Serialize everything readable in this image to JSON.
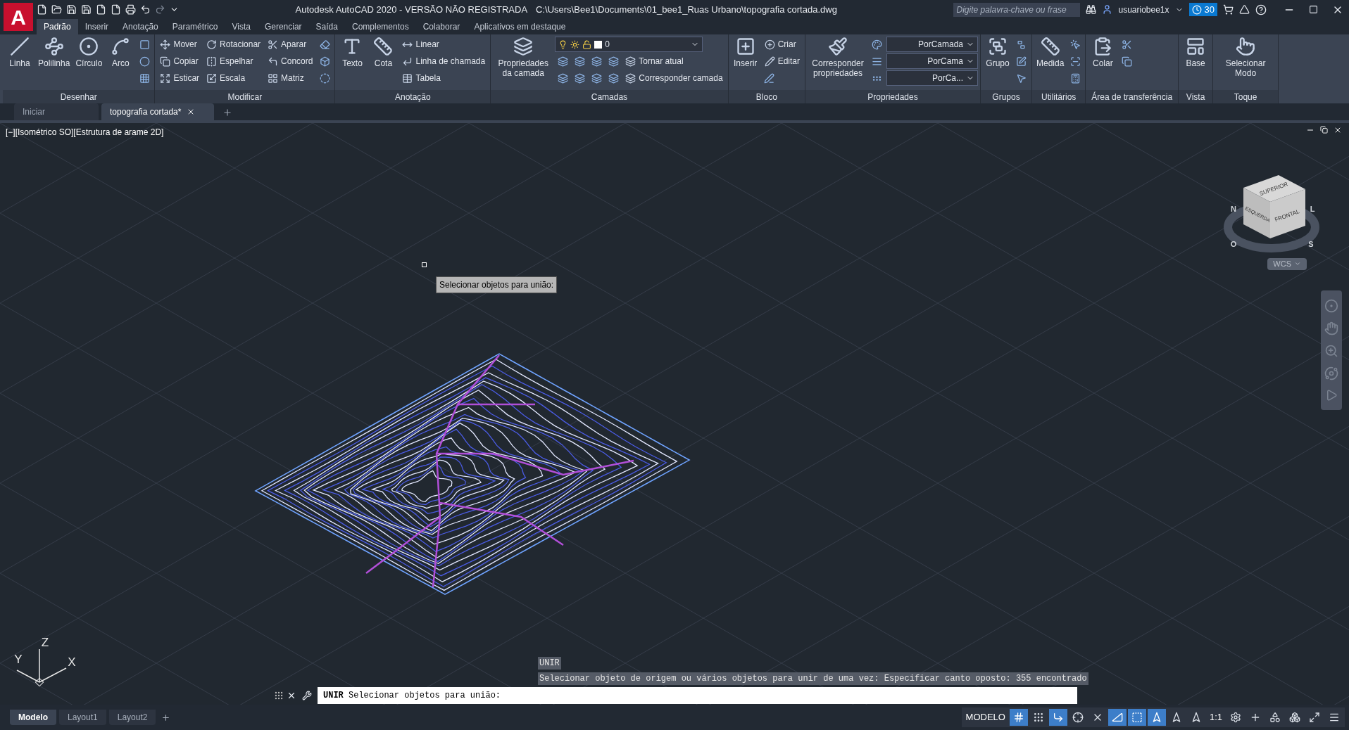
{
  "logo_letter": "A",
  "app_title": "Autodesk AutoCAD 2020 - VERSÃO NÃO REGISTRADA",
  "file_path": "C:\\Users\\Bee1\\Documents\\01_bee1_Ruas Urbano\\topografia cortada.dwg",
  "search": {
    "placeholder": "Digite palavra-chave ou frase"
  },
  "user": "usuariobee1x",
  "trial_days": "30",
  "ribbon_tabs": [
    {
      "label": "Padrão",
      "selected": true
    },
    {
      "label": "Inserir",
      "selected": false
    },
    {
      "label": "Anotação",
      "selected": false
    },
    {
      "label": "Paramétrico",
      "selected": false
    },
    {
      "label": "Vista",
      "selected": false
    },
    {
      "label": "Gerenciar",
      "selected": false
    },
    {
      "label": "Saída",
      "selected": false
    },
    {
      "label": "Complementos",
      "selected": false
    },
    {
      "label": "Colaborar",
      "selected": false
    },
    {
      "label": "Aplicativos em destaque",
      "selected": false
    }
  ],
  "ribbon_panels": [
    {
      "title": "Desenhar",
      "large": [
        "Linha",
        "Polilinha",
        "Círculo",
        "Arco"
      ],
      "rows": [
        [
          {
            "kind": "icon"
          }
        ],
        [
          {
            "kind": "icon"
          }
        ],
        [
          {
            "kind": "icon"
          }
        ]
      ]
    },
    {
      "title": "Modificar",
      "rows": [
        [
          {
            "kind": "small",
            "label": "Mover"
          },
          {
            "kind": "small",
            "label": "Rotacionar"
          },
          {
            "kind": "small",
            "label": "Aparar"
          },
          {
            "kind": "icon"
          }
        ],
        [
          {
            "kind": "small",
            "label": "Copiar"
          },
          {
            "kind": "small",
            "label": "Espelhar"
          },
          {
            "kind": "small",
            "label": "Concord"
          },
          {
            "kind": "icon"
          }
        ],
        [
          {
            "kind": "small",
            "label": "Esticar"
          },
          {
            "kind": "small",
            "label": "Escala"
          },
          {
            "kind": "small",
            "label": "Matriz"
          },
          {
            "kind": "icon"
          }
        ]
      ]
    },
    {
      "title": "Anotação",
      "large": [
        "Texto",
        "Cota"
      ],
      "rows": [
        [
          {
            "kind": "small",
            "label": "Linear"
          }
        ],
        [
          {
            "kind": "small",
            "label": "Linha de chamada"
          }
        ],
        [
          {
            "kind": "small",
            "label": "Tabela"
          }
        ]
      ]
    },
    {
      "title": "Camadas",
      "large": [
        "Propriedades da camada"
      ],
      "rows": [
        [
          {
            "kind": "layer",
            "label": "0"
          }
        ],
        [
          {
            "kind": "icon"
          },
          {
            "kind": "icon"
          },
          {
            "kind": "icon"
          },
          {
            "kind": "icon"
          },
          {
            "kind": "small",
            "label": "Tornar atual"
          }
        ],
        [
          {
            "kind": "icon"
          },
          {
            "kind": "icon"
          },
          {
            "kind": "icon"
          },
          {
            "kind": "icon"
          },
          {
            "kind": "small",
            "label": "Corresponder camada"
          }
        ]
      ]
    },
    {
      "title": "Bloco",
      "large": [
        "Inserir"
      ],
      "rows": [
        [
          {
            "kind": "small",
            "label": "Criar"
          }
        ],
        [
          {
            "kind": "small",
            "label": "Editar"
          }
        ],
        [
          {
            "kind": "icon"
          }
        ]
      ]
    },
    {
      "title": "Propriedades",
      "large": [
        "Corresponder propriedades"
      ],
      "rows": [
        [
          {
            "kind": "icon"
          },
          {
            "kind": "prop",
            "label": "PorCamada"
          }
        ],
        [
          {
            "kind": "icon"
          },
          {
            "kind": "prop",
            "label": "PorCama"
          }
        ],
        [
          {
            "kind": "icon"
          },
          {
            "kind": "prop",
            "label": "PorCa..."
          }
        ]
      ]
    },
    {
      "title": "Grupos",
      "large": [
        "Grupo"
      ],
      "rows": [
        [
          {
            "kind": "icon"
          }
        ],
        [
          {
            "kind": "icon"
          }
        ],
        [
          {
            "kind": "icon"
          }
        ]
      ]
    },
    {
      "title": "Utilitários",
      "large": [
        "Medida"
      ],
      "rows": [
        [
          {
            "kind": "icon"
          }
        ],
        [
          {
            "kind": "icon"
          }
        ],
        [
          {
            "kind": "icon"
          }
        ]
      ]
    },
    {
      "title": "Área de transferência",
      "large": [
        "Colar"
      ],
      "rows": [
        [
          {
            "kind": "icon"
          }
        ],
        [
          {
            "kind": "icon"
          }
        ]
      ]
    },
    {
      "title": "Vista",
      "large": [
        "Base"
      ]
    },
    {
      "title": "Toque",
      "large": [
        "Selecionar Modo"
      ]
    }
  ],
  "file_tabs": [
    {
      "label": "Iniciar",
      "selected": false
    },
    {
      "label": "topografia cortada*",
      "selected": true
    }
  ],
  "viewport_label": "[−][Isométrico SO][Estrutura de arame 2D]",
  "tooltip": "Selecionar objetos para união:",
  "viewcube": {
    "faces": [
      "SUPERIOR",
      "ESQUERDA",
      "FRONTAL"
    ],
    "compass": [
      "N",
      "L",
      "O",
      "S"
    ]
  },
  "ucs_menu": "WCS",
  "ucs_axes": [
    "X",
    "Y",
    "Z"
  ],
  "command_history": [
    "UNIR",
    "Selecionar objeto de origem ou vários objetos para unir de uma vez: Especificar canto oposto: 355 encontrado"
  ],
  "command_prompt": "**UNIR** Selecionar objetos para união:",
  "layout_tabs": [
    {
      "label": "Modelo",
      "selected": true
    },
    {
      "label": "Layout1",
      "selected": false
    },
    {
      "label": "Layout2",
      "selected": false
    }
  ],
  "status_bar": [
    {
      "kind": "label",
      "label": "MODELO"
    },
    {
      "kind": "toggle",
      "on": true
    },
    {
      "kind": "toggle",
      "on": false
    },
    {
      "kind": "toggle",
      "on": true
    },
    {
      "kind": "toggle",
      "on": false
    },
    {
      "kind": "toggle",
      "on": false
    },
    {
      "kind": "toggle",
      "on": true
    },
    {
      "kind": "toggle",
      "on": true
    },
    {
      "kind": "toggle",
      "on": true
    },
    {
      "kind": "toggle",
      "on": false
    },
    {
      "kind": "toggle",
      "on": false
    },
    {
      "kind": "label",
      "label": "1:1"
    },
    {
      "kind": "toggle",
      "on": false
    },
    {
      "kind": "toggle",
      "on": false
    },
    {
      "kind": "toggle",
      "on": false
    },
    {
      "kind": "toggle",
      "on": false
    },
    {
      "kind": "toggle",
      "on": false
    },
    {
      "kind": "toggle",
      "on": false
    }
  ]
}
